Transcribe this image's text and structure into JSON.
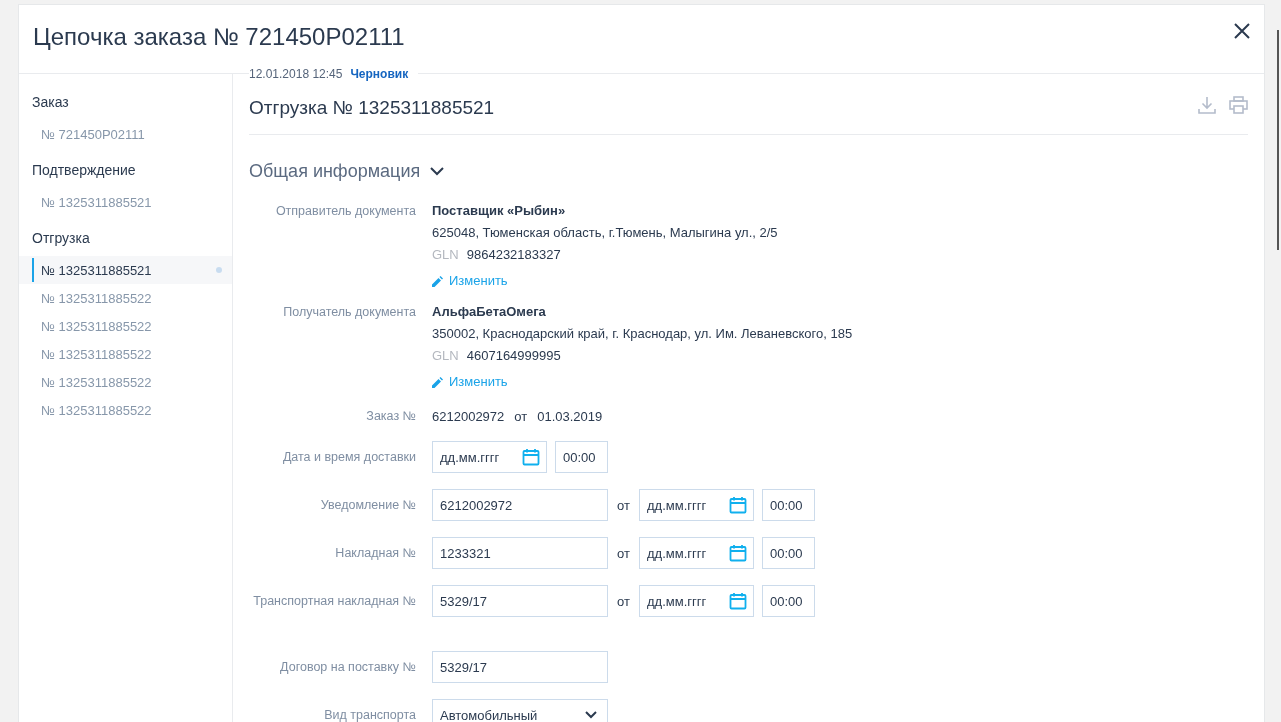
{
  "window": {
    "title": "Цепочка заказа № 721450P02111"
  },
  "sidebar": {
    "groups": [
      {
        "title": "Заказ",
        "items": [
          {
            "label": "№ 721450P02111",
            "selected": false,
            "dot": false
          }
        ]
      },
      {
        "title": "Подтверждение",
        "items": [
          {
            "label": "№ 1325311885521",
            "selected": false,
            "dot": false
          }
        ]
      },
      {
        "title": "Отгрузка",
        "items": [
          {
            "label": "№ 1325311885521",
            "selected": true,
            "dot": true
          },
          {
            "label": "№ 1325311885522",
            "selected": false,
            "dot": false
          },
          {
            "label": "№ 1325311885522",
            "selected": false,
            "dot": false
          },
          {
            "label": "№ 1325311885522",
            "selected": false,
            "dot": false
          },
          {
            "label": "№ 1325311885522",
            "selected": false,
            "dot": false
          },
          {
            "label": "№ 1325311885522",
            "selected": false,
            "dot": false
          }
        ]
      }
    ]
  },
  "document": {
    "timestamp": "12.01.2018 12:45",
    "status": "Черновик",
    "title": "Отгрузка № 1325311885521",
    "section": {
      "title": "Общая информация",
      "expanded": true
    },
    "parties": [
      {
        "label": "Отправитель документа",
        "name": "Поставщик «Рыбин»",
        "address": "625048, Тюменская область, г.Тюмень, Малыгина ул., 2/5",
        "gln_label": "GLN",
        "gln": "9864232183327",
        "edit": "Изменить"
      },
      {
        "label": "Получатель документа",
        "name": "АльфаБетаОмега",
        "address": "350002, Краснодарский край, г. Краснодар, ул. Им. Леваневского, 185",
        "gln_label": "GLN",
        "gln": "4607164999995",
        "edit": "Изменить"
      }
    ],
    "order": {
      "label": "Заказ №",
      "number": "6212002972",
      "from": "от",
      "date": "01.03.2019"
    },
    "references": [
      {
        "kind": "datetime",
        "label": "Дата и время доставки",
        "date_placeholder": "дд.мм.гггг",
        "time": "00:00"
      },
      {
        "kind": "numbered",
        "label": "Уведомление №",
        "value": "6212002972",
        "from": "от",
        "date_placeholder": "дд.мм.гггг",
        "time": "00:00"
      },
      {
        "kind": "numbered",
        "label": "Накладная №",
        "value": "1233321",
        "from": "от",
        "date_placeholder": "дд.мм.гггг",
        "time": "00:00"
      },
      {
        "kind": "numbered",
        "label": "Транспортная накладная №",
        "value": "5329/17",
        "from": "от",
        "date_placeholder": "дд.мм.гггг",
        "time": "00:00"
      }
    ],
    "agreement": [
      {
        "kind": "text",
        "label": "Договор на поставку №",
        "value": "5329/17"
      },
      {
        "kind": "select",
        "label": "Вид транспорта",
        "value": "Автомобильный"
      }
    ]
  }
}
